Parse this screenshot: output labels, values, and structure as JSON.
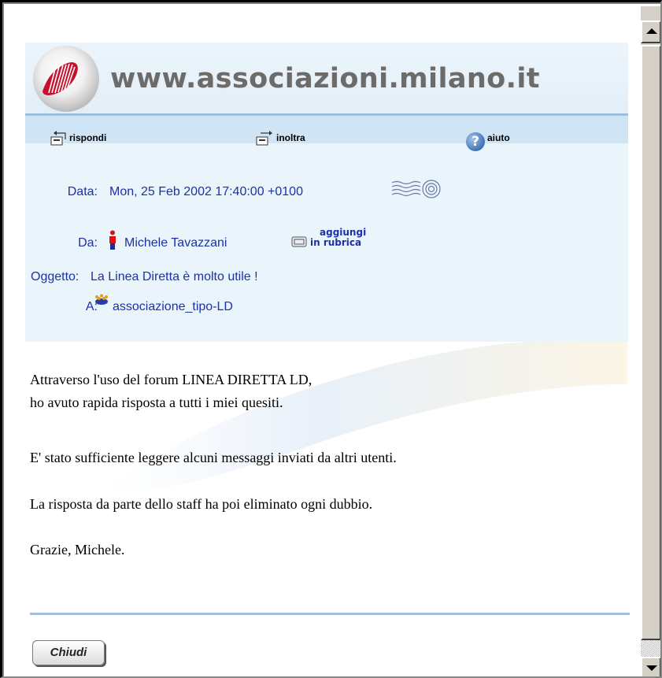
{
  "brand": {
    "site_name": "www.associazioni.milano.it"
  },
  "toolbar": {
    "reply": "rispondi",
    "forward": "inoltra",
    "help": "aiuto"
  },
  "message": {
    "date_label": "Data:",
    "date_value": "Mon, 25 Feb 2002 17:40:00 +0100",
    "from_label": "Da:",
    "from_value": "Michele Tavazzani",
    "add_contact_line1": "aggiungi",
    "add_contact_line2": "in rubrica",
    "subject_label": "Oggetto:",
    "subject_value": "La Linea Diretta è molto utile !",
    "to_label": "A:",
    "to_value": "associazione_tipo-LD"
  },
  "body": {
    "lines": [
      "Attraverso l'uso del forum LINEA DIRETTA LD,",
      "ho avuto rapida risposta a tutti i miei quesiti.",
      "E' stato sufficiente leggere alcuni messaggi inviati da altri utenti.",
      "La risposta da parte dello staff ha poi eliminato ogni dubbio.",
      "Grazie, Michele."
    ]
  },
  "footer": {
    "close_label": "Chiudi"
  },
  "colors": {
    "accent_text": "#1d31a8",
    "toolbar_bg": "#cfe5f5",
    "panel_bg": "#eaf4fb",
    "rule": "#9fbfdc"
  },
  "icons": [
    "reply-icon",
    "forward-icon",
    "help-icon",
    "stamp-icon",
    "person-icon",
    "address-book-icon",
    "group-icon",
    "logo-icon"
  ]
}
